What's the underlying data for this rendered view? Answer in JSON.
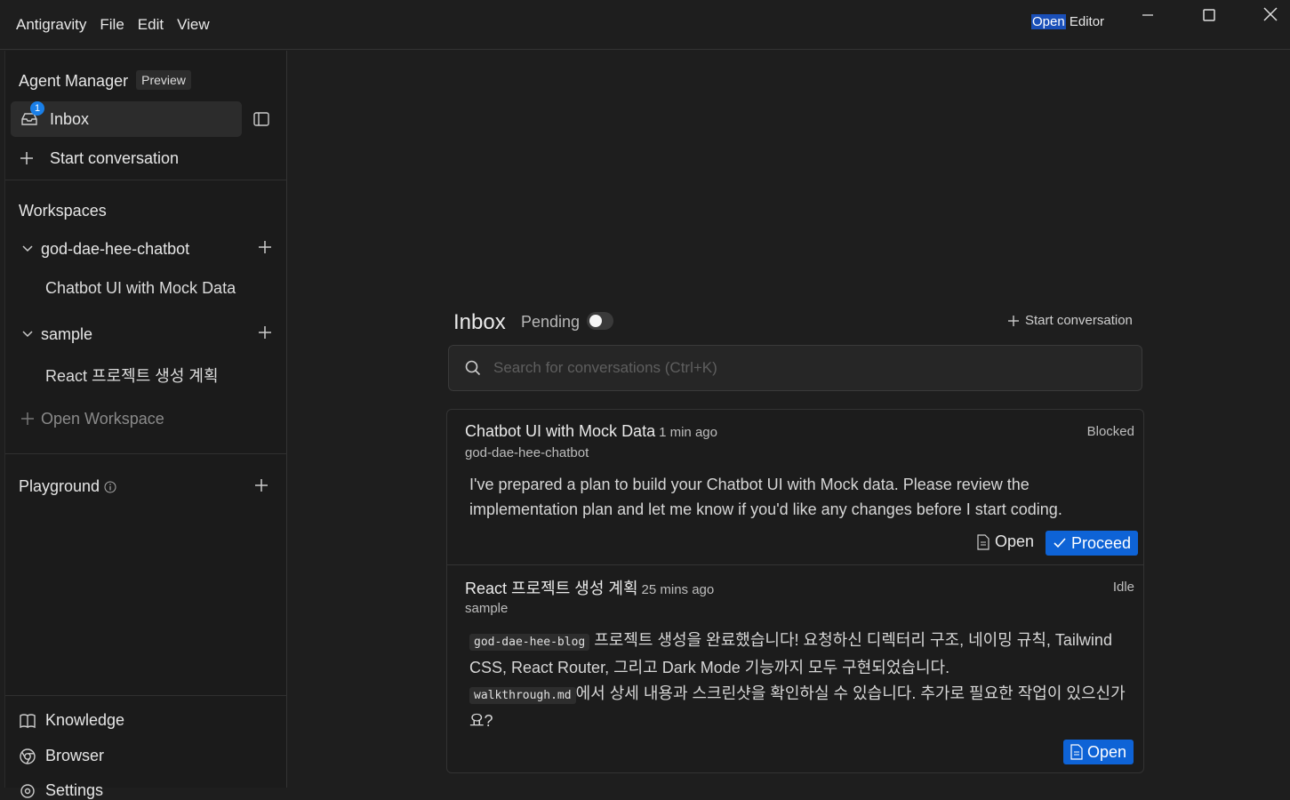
{
  "titlebar": {
    "menu": [
      "Antigravity",
      "File",
      "Edit",
      "View"
    ],
    "open_editor_highlight": "Open",
    "open_editor_rest": " Editor"
  },
  "sidebar": {
    "agent_manager": "Agent Manager",
    "preview_badge": "Preview",
    "inbox_label": "Inbox",
    "inbox_count": "1",
    "start_conversation": "Start conversation",
    "workspaces_heading": "Workspaces",
    "workspaces": [
      {
        "name": "god-dae-hee-chatbot",
        "children": [
          "Chatbot UI with Mock Data"
        ]
      },
      {
        "name": "sample",
        "children": [
          "React 프로젝트 생성 계획"
        ]
      }
    ],
    "open_workspace": "Open Workspace",
    "playground": "Playground",
    "knowledge": "Knowledge",
    "browser": "Browser",
    "settings": "Settings"
  },
  "main": {
    "inbox_title": "Inbox",
    "pending_label": "Pending",
    "pending_on": false,
    "start_conversation": "Start conversation",
    "search_placeholder": "Search for conversations (Ctrl+K)",
    "conversations": [
      {
        "title": "Chatbot UI with Mock Data",
        "time": "1 min ago",
        "status": "Blocked",
        "workspace": "god-dae-hee-chatbot",
        "body": "I've prepared a plan to build your Chatbot UI with Mock data. Please review the implementation plan and let me know if you'd like any changes before I start coding.",
        "open_label": "Open",
        "proceed_label": "Proceed"
      },
      {
        "title": "React 프로젝트 생성 계획",
        "time": "25 mins ago",
        "status": "Idle",
        "workspace": "sample",
        "code1": "god-dae-hee-blog",
        "body1": " 프로젝트 생성을 완료했습니다! 요청하신 디렉터리 구조, 네이밍 규칙, Tailwind CSS, React Router, 그리고 Dark Mode 기능까지 모두 구현되었습니다.",
        "code2": "walkthrough.md",
        "body2": "에서 상세 내용과 스크린샷을 확인하실 수 있습니다. 추가로 필요한 작업이 있으신가요?",
        "open_label": "Open"
      }
    ]
  },
  "colors": {
    "accent": "#0e63d6",
    "badge": "#1a7fe8",
    "background": "#1e1e1e"
  }
}
